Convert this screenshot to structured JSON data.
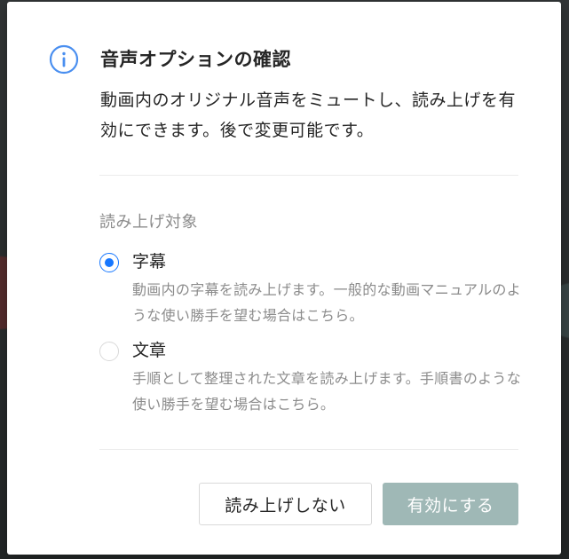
{
  "dialog": {
    "title": "音声オプションの確認",
    "description": "動画内のオリジナル音声をミュートし、読み上げを有効にできます。後で変更可能です。",
    "section_label": "読み上げ対象",
    "options": [
      {
        "label": "字幕",
        "description": "動画内の字幕を読み上げます。一般的な動画マニュアルのような使い勝手を望む場合はこちら。",
        "selected": true
      },
      {
        "label": "文章",
        "description": "手順として整理された文章を読み上げます。手順書のような使い勝手を望む場合はこちら。",
        "selected": false
      }
    ],
    "buttons": {
      "cancel_label": "読み上げしない",
      "confirm_label": "有効にする"
    }
  },
  "icons": {
    "header_icon": "info-circle-icon"
  },
  "colors": {
    "accent": "#1677ff",
    "info_icon": "#4a8ff0",
    "confirm_button_bg": "#9fb8b6",
    "muted_text": "#8c8c8c",
    "body_text": "#262626"
  }
}
